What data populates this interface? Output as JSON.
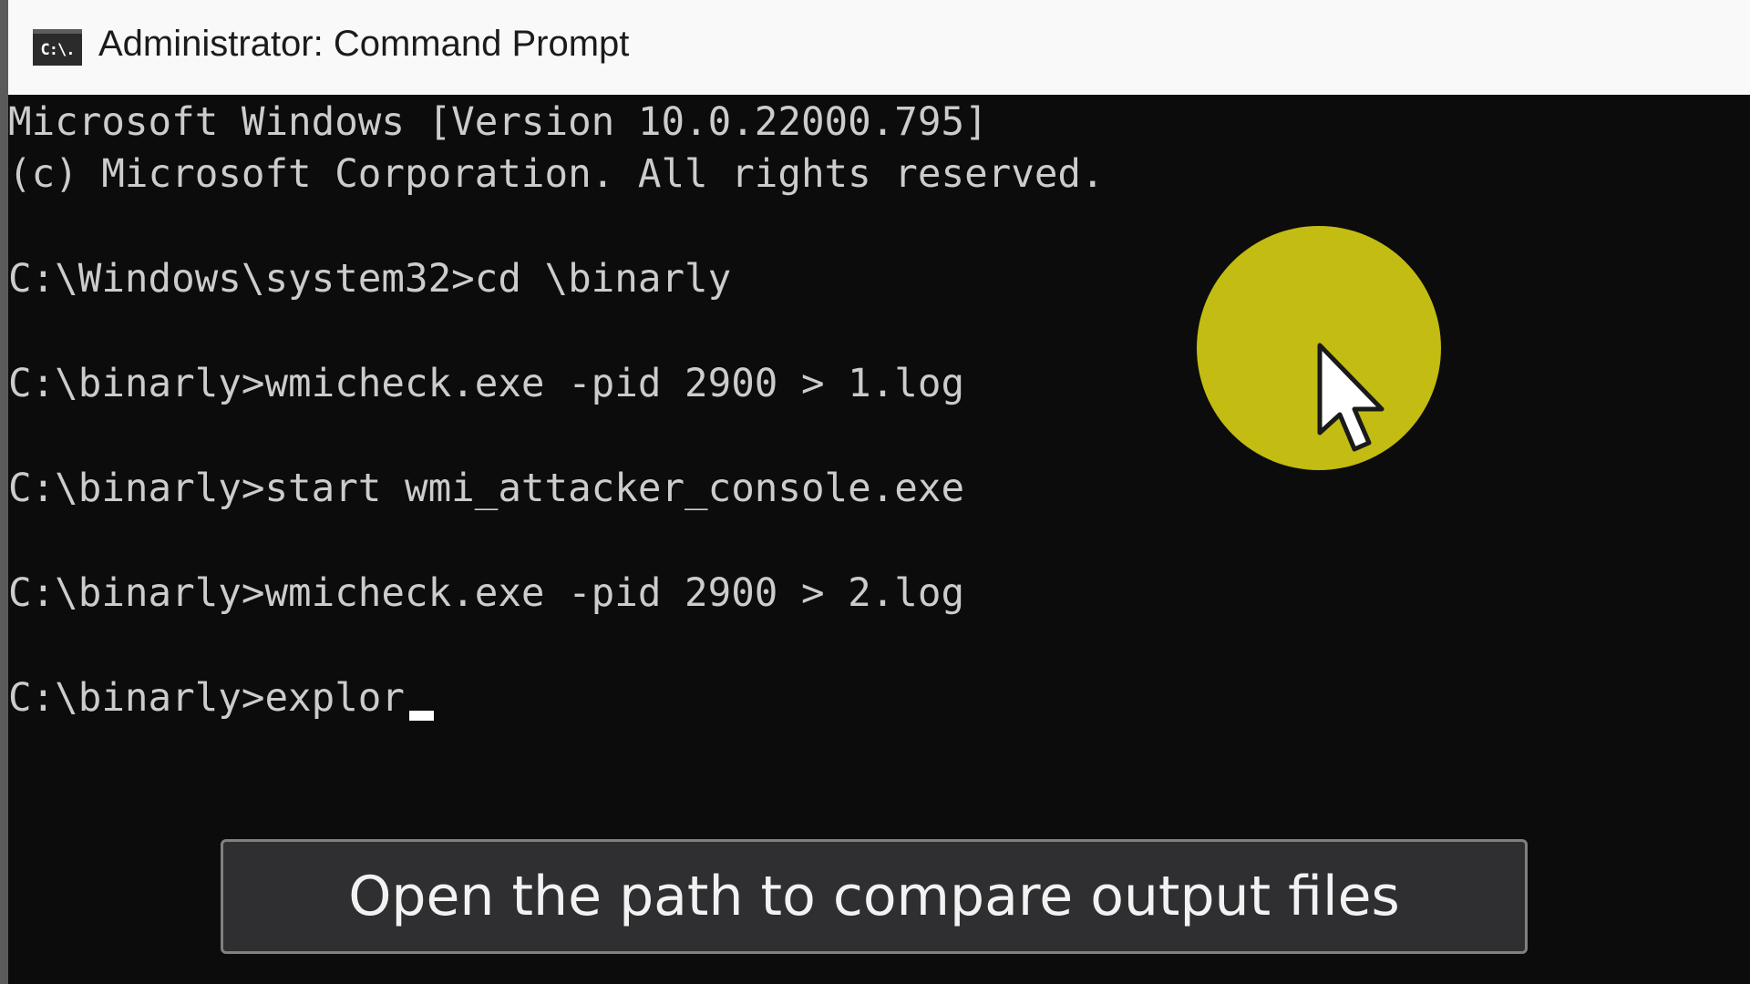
{
  "window": {
    "title": "Administrator: Command Prompt",
    "icon": "cmd-icon",
    "icon_text": "C:\\."
  },
  "console": {
    "lines": [
      "Microsoft Windows [Version 10.0.22000.795]",
      "(c) Microsoft Corporation. All rights reserved.",
      "C:\\Windows\\system32>cd \\binarly",
      "C:\\binarly>wmicheck.exe -pid 2900 > 1.log",
      "C:\\binarly>start wmi_attacker_console.exe",
      "C:\\binarly>wmicheck.exe -pid 2900 > 2.log",
      "C:\\binarly>explor"
    ],
    "text_color": "#cccccc",
    "background": "#0c0c0c"
  },
  "overlay": {
    "highlight_color": "#c3bc12",
    "pointer_icon": "mouse-pointer-icon"
  },
  "caption": {
    "text": "Open the path to compare output files"
  }
}
